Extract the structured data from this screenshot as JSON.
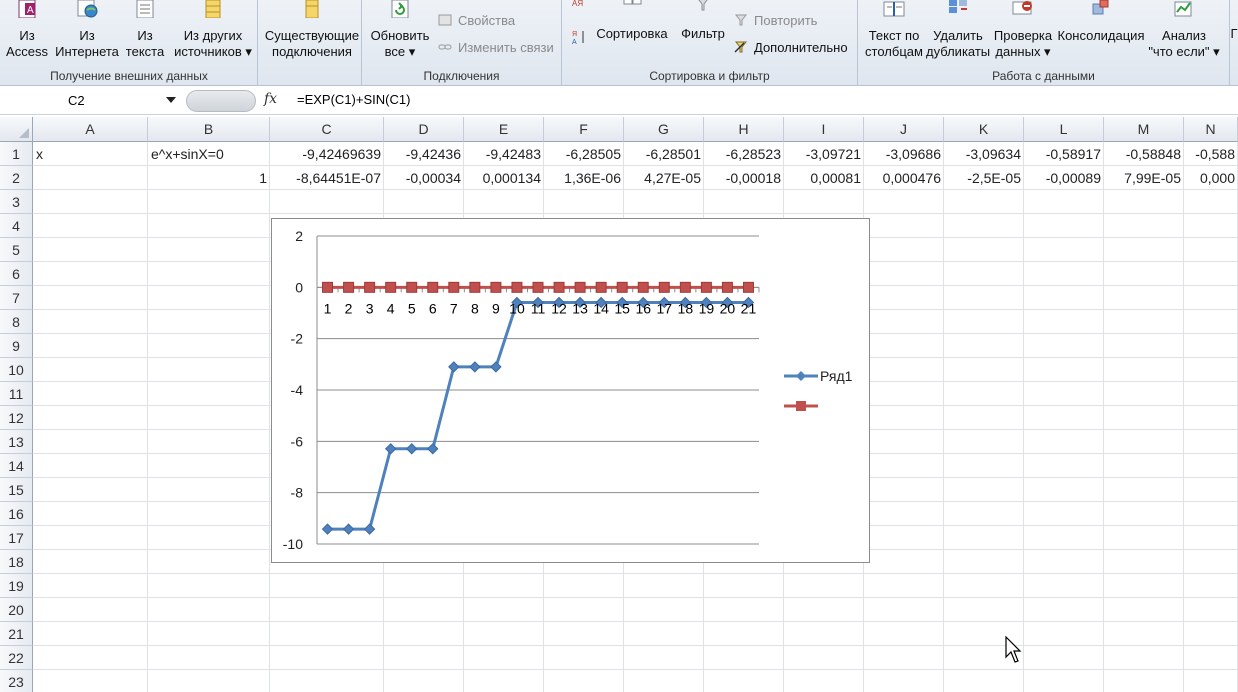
{
  "ribbon": {
    "external_data": {
      "label": "Получение внешних данных",
      "buttons": [
        {
          "line1": "Из",
          "line2": "Access"
        },
        {
          "line1": "Из",
          "line2": "Интернета"
        },
        {
          "line1": "Из",
          "line2": "текста"
        },
        {
          "line1": "Из других",
          "line2": "источников ▾"
        },
        {
          "line1": "Существующие",
          "line2": "подключения"
        }
      ]
    },
    "connections": {
      "label": "Подключения",
      "refresh": {
        "line1": "Обновить",
        "line2": "все ▾"
      },
      "properties": "Свойства",
      "edit_links": "Изменить связи"
    },
    "sort_filter": {
      "label": "Сортировка и фильтр",
      "sort": "Сортировка",
      "filter": "Фильтр",
      "reapply": "Повторить",
      "advanced": "Дополнительно"
    },
    "data_tools": {
      "label": "Работа с данными",
      "buttons": [
        {
          "line1": "Текст по",
          "line2": "столбцам"
        },
        {
          "line1": "Удалить",
          "line2": "дубликаты"
        },
        {
          "line1": "Проверка",
          "line2": "данных ▾"
        },
        {
          "line1": "Консолидация",
          "line2": ""
        },
        {
          "line1": "Анализ",
          "line2": "\"что если\" ▾"
        }
      ],
      "partial": "Г"
    }
  },
  "formula_bar": {
    "name_box": "C2",
    "fx": "fx",
    "formula": "=EXP(C1)+SIN(C1)"
  },
  "columns": [
    "A",
    "B",
    "C",
    "D",
    "E",
    "F",
    "G",
    "H",
    "I",
    "J",
    "K",
    "L",
    "M",
    "N"
  ],
  "rows": [
    "1",
    "2",
    "3",
    "4",
    "5",
    "6",
    "7",
    "8",
    "9",
    "10",
    "11",
    "12",
    "13",
    "14",
    "15",
    "16",
    "17",
    "18",
    "19",
    "20",
    "21",
    "22",
    "23"
  ],
  "cells": {
    "A1": "x",
    "B1": "e^x+sinX=0",
    "C1": "-9,42469639",
    "D1": "-9,42436",
    "E1": "-9,42483",
    "F1": "-6,28505",
    "G1": "-6,28501",
    "H1": "-6,28523",
    "I1": "-3,09721",
    "J1": "-3,09686",
    "K1": "-3,09634",
    "L1": "-0,58917",
    "M1": "-0,58848",
    "N1": "-0,588",
    "B2": "1",
    "C2": "-8,64451E-07",
    "D2": "-0,00034",
    "E2": "0,000134",
    "F2": "1,36E-06",
    "G2": "4,27E-05",
    "H2": "-0,00018",
    "I2": "0,00081",
    "J2": "0,000476",
    "K2": "-2,5E-05",
    "L2": "-0,00089",
    "M2": "7,99E-05",
    "N2": "0,000"
  },
  "chart_data": {
    "type": "line",
    "categories": [
      "1",
      "2",
      "3",
      "4",
      "5",
      "6",
      "7",
      "8",
      "9",
      "10",
      "11",
      "12",
      "13",
      "14",
      "15",
      "16",
      "17",
      "18",
      "19",
      "20",
      "21"
    ],
    "series": [
      {
        "name": "Ряд1",
        "color": "#4f81bd",
        "marker": "diamond",
        "values": [
          -9.42,
          -9.42,
          -9.42,
          -6.29,
          -6.29,
          -6.29,
          -3.1,
          -3.1,
          -3.1,
          -0.59,
          -0.59,
          -0.59,
          -0.59,
          -0.59,
          -0.59,
          -0.59,
          -0.59,
          -0.59,
          -0.59,
          -0.59,
          -0.59
        ]
      },
      {
        "name": "",
        "color": "#c0504d",
        "marker": "square",
        "values": [
          0,
          0,
          0,
          0,
          0,
          0,
          0,
          0,
          0,
          0,
          0,
          0,
          0,
          0,
          0,
          0,
          0,
          0,
          0,
          0,
          0
        ]
      }
    ],
    "yticks": [
      "2",
      "0",
      "-2",
      "-4",
      "-6",
      "-8",
      "-10"
    ],
    "ylim": [
      -10,
      2
    ],
    "grid": true,
    "legend_position": "right"
  }
}
